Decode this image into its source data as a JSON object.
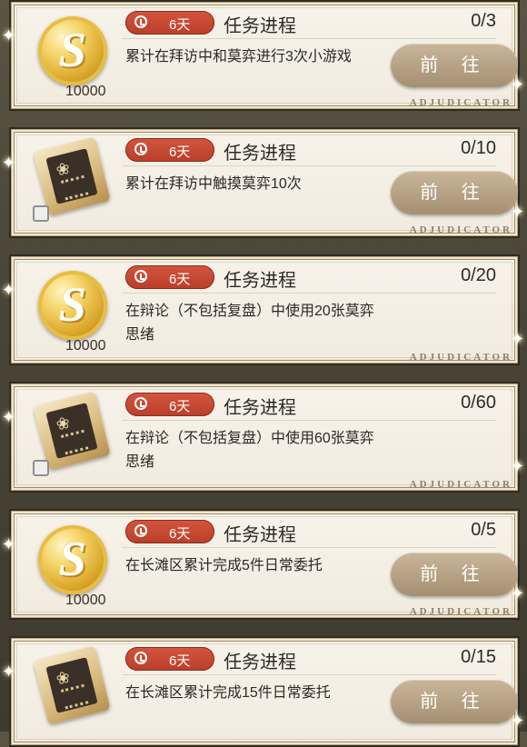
{
  "brand": "ADJUDICATOR",
  "go_label": "前 往",
  "progress_title": "任务进程",
  "tasks": [
    {
      "reward": "coin",
      "quantity": "10000",
      "days": "6天",
      "progress": "0/3",
      "desc": "累计在拜访中和莫弈进行3次小游戏"
    },
    {
      "reward": "book",
      "quantity": "",
      "days": "6天",
      "progress": "0/10",
      "desc": "累计在拜访中触摸莫弈10次"
    },
    {
      "reward": "coin",
      "quantity": "10000",
      "days": "6天",
      "progress": "0/20",
      "desc": "在辩论（不包括复盘）中使用20张莫弈思绪"
    },
    {
      "reward": "book",
      "quantity": "",
      "days": "6天",
      "progress": "0/60",
      "desc": "在辩论（不包括复盘）中使用60张莫弈思绪"
    },
    {
      "reward": "coin",
      "quantity": "10000",
      "days": "6天",
      "progress": "0/5",
      "desc": "在长滩区累计完成5件日常委托"
    },
    {
      "reward": "book",
      "quantity": "",
      "days": "6天",
      "progress": "0/15",
      "desc": "在长滩区累计完成15件日常委托"
    }
  ],
  "colors": {
    "timer": "#c8492f",
    "button": "#b5a084",
    "card": "#f4efe4"
  }
}
